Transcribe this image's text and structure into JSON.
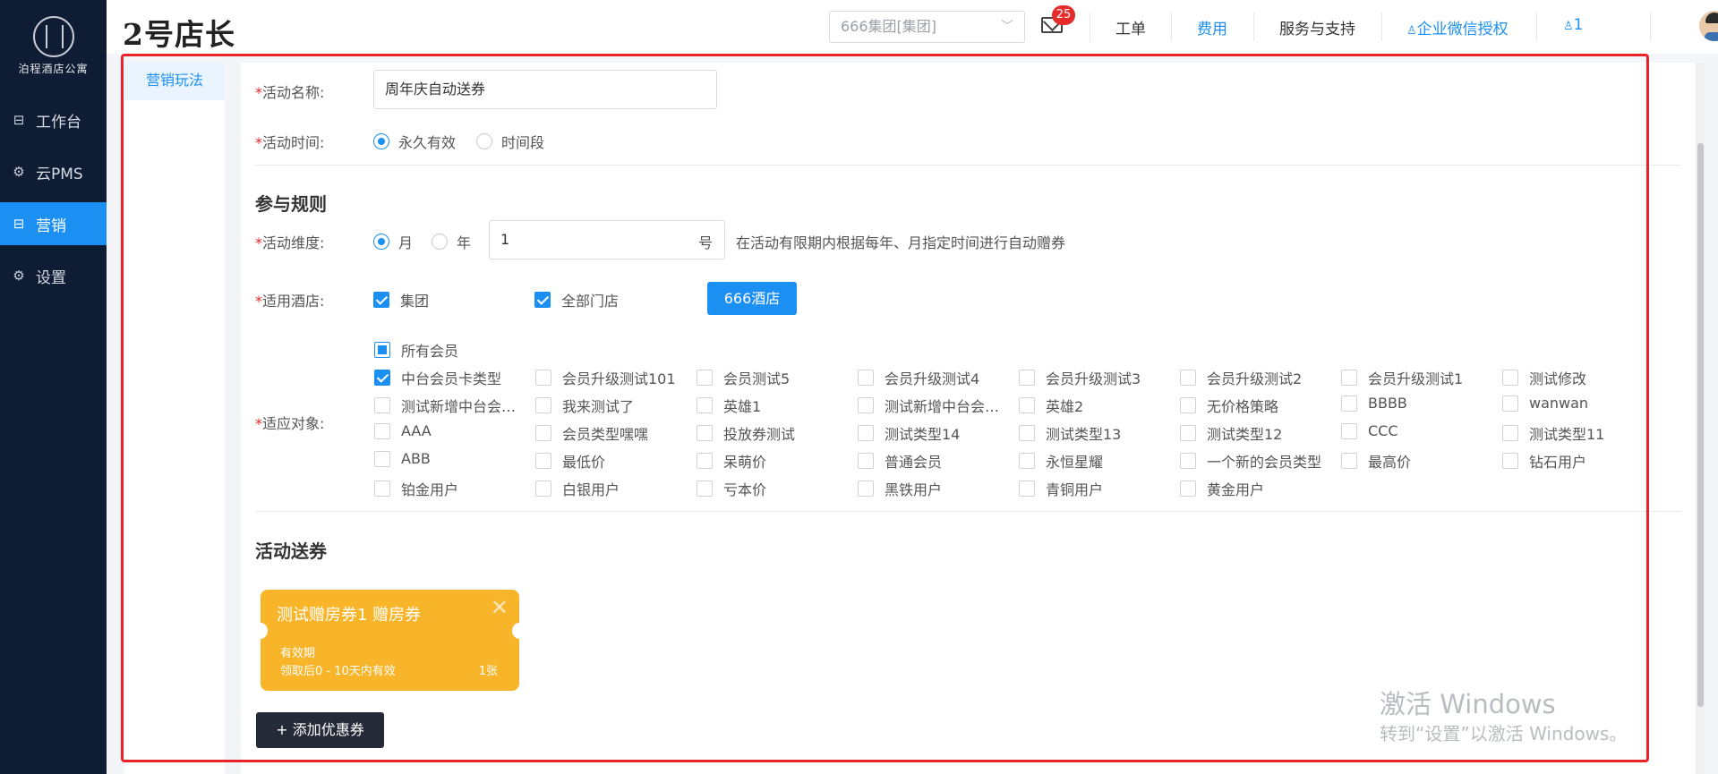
{
  "sidebar": {
    "logo_text": "泊程酒店公寓",
    "items": [
      {
        "label": "工作台",
        "icon": "workbench-icon"
      },
      {
        "label": "云PMS",
        "icon": "gear-icon"
      },
      {
        "label": "营销",
        "icon": "marketing-icon",
        "active": true
      },
      {
        "label": "设置",
        "icon": "gear-icon"
      }
    ]
  },
  "header": {
    "brand": "2号店长",
    "org_select": "666集团[集团]",
    "mail_badge": "25",
    "links": [
      "工单",
      "费用",
      "服务与支持",
      "企业微信授权"
    ],
    "user_label": "1"
  },
  "subnav": {
    "item": "营销玩法"
  },
  "form": {
    "activity_name_label": "活动名称:",
    "activity_name_value": "周年庆自动送券",
    "activity_time_label": "活动时间:",
    "time_options": [
      "永久有效",
      "时间段"
    ],
    "rules_title": "参与规则",
    "dimension_label": "活动维度:",
    "dimension_options": [
      "月",
      "年"
    ],
    "day_value": "1",
    "day_suffix": "号",
    "dimension_hint": "在活动有限期内根据每年、月指定时间进行自动赠券",
    "hotel_label": "适用酒店:",
    "hotel_group": "集团",
    "hotel_all": "全部门店",
    "hotel_button": "666酒店",
    "target_label": "适应对象:",
    "all_members": "所有会员",
    "members": [
      "中台会员卡类型",
      "会员升级测试101",
      "会员测试5",
      "会员升级测试4",
      "会员升级测试3",
      "会员升级测试2",
      "会员升级测试1",
      "测试修改",
      "测试新增中台会员...",
      "我来测试了",
      "英雄1",
      "测试新增中台会员...",
      "英雄2",
      "无价格策略",
      "BBBB",
      "wanwan",
      "AAA",
      "会员类型嘿嘿",
      "投放券测试",
      "测试类型14",
      "测试类型13",
      "测试类型12",
      "CCC",
      "测试类型11",
      "ABB",
      "最低价",
      "呆萌价",
      "普通会员",
      "永恒星耀",
      "一个新的会员类型",
      "最高价",
      "钻石用户",
      "铂金用户",
      "白银用户",
      "亏本价",
      "黑铁用户",
      "青铜用户",
      "黄金用户"
    ],
    "coupon_title": "活动送券",
    "coupon": {
      "name": "测试赠房券1 赠房券",
      "validity_label": "有效期",
      "validity_desc": "领取后0 - 10天内有效",
      "count": "1张"
    },
    "add_coupon": "+ 添加优惠券"
  },
  "watermark": {
    "line1": "激活 Windows",
    "line2": "转到“设置”以激活 Windows。"
  },
  "colors": {
    "accent": "#1c8ff2",
    "sidebar": "#0e1c34",
    "coupon": "#f9b52a",
    "frame": "#e8242a"
  }
}
